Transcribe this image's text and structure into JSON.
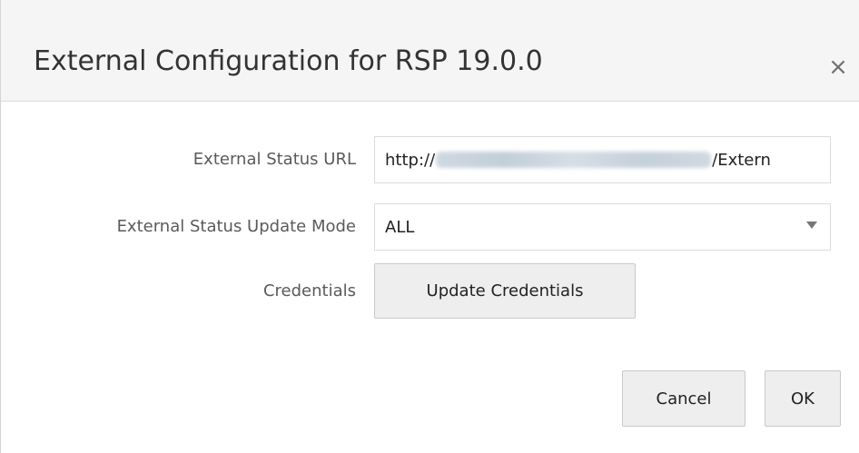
{
  "dialog": {
    "title": "External Configuration for RSP 19.0.0",
    "close_glyph": "×",
    "close_icon": "close-icon"
  },
  "form": {
    "url": {
      "label": "External Status URL",
      "value_prefix": "http://",
      "value_suffix": "/Extern"
    },
    "update_mode": {
      "label": "External Status Update Mode",
      "selected": "ALL"
    },
    "credentials": {
      "label": "Credentials",
      "button_label": "Update Credentials"
    }
  },
  "footer": {
    "cancel_label": "Cancel",
    "ok_label": "OK"
  }
}
